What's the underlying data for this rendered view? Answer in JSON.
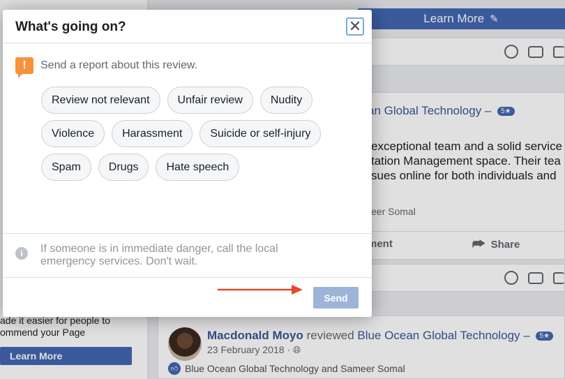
{
  "background": {
    "top_cta": {
      "label": "Learn More",
      "icon": "pencil-icon"
    },
    "composer_icons": [
      "smiley-icon",
      "camera-icon",
      "gif-icon"
    ],
    "post": {
      "page_name": "an Global Technology –",
      "rating": "5★",
      "body": "exceptional team and a solid service\ntation Management space. Their tea\nsues online for both individuals and",
      "likes": "eer Somal",
      "actions": {
        "comment": "ment",
        "share": "Share"
      }
    },
    "left_panel": {
      "text_lines": [
        "ade it easier for people to",
        "ommend your Page"
      ],
      "button": "Learn More"
    },
    "post2": {
      "author": "Macdonald Moyo",
      "verb": "reviewed",
      "page": "Blue Ocean Global Technology –",
      "rating": "5★",
      "date": "23 February 2018 ·",
      "likes": "Blue Ocean Global Technology and Sameer Somal"
    }
  },
  "modal": {
    "title": "What's going on?",
    "close_icon": "close-icon",
    "report_text": "Send a report about this review.",
    "options": [
      "Review not relevant",
      "Unfair review",
      "Nudity",
      "Violence",
      "Harassment",
      "Suicide or self-injury",
      "Spam",
      "Drugs",
      "Hate speech"
    ],
    "danger_text": "If someone is in immediate danger, call the local emergency services. Don't wait.",
    "send_label": "Send"
  },
  "colors": {
    "accent": "#4267b2",
    "send_disabled": "#9cb4d8",
    "report_icon": "#f7923b",
    "annotation_arrow": "#e8472a"
  }
}
